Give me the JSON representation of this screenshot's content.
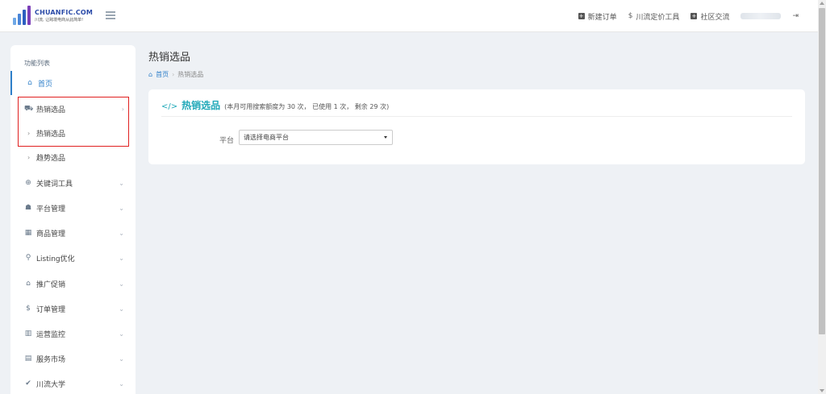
{
  "header": {
    "logo_title": "CHUANFIC.COM",
    "logo_subtitle": "川流, 让跨境电商从此简单!",
    "links": [
      {
        "label": "新建订单"
      },
      {
        "label": "川流定价工具"
      },
      {
        "label": "社区交流"
      }
    ]
  },
  "sidebar": {
    "title": "功能列表",
    "items": [
      {
        "label": "首页"
      },
      {
        "label": "热销选品"
      },
      {
        "label": "热销选品"
      },
      {
        "label": "趋势选品"
      },
      {
        "label": "关键词工具"
      },
      {
        "label": "平台管理"
      },
      {
        "label": "商品管理"
      },
      {
        "label": "Listing优化"
      },
      {
        "label": "推广促销"
      },
      {
        "label": "订单管理"
      },
      {
        "label": "运营监控"
      },
      {
        "label": "服务市场"
      },
      {
        "label": "川流大学"
      }
    ]
  },
  "main": {
    "page_title": "热销选品",
    "breadcrumb_home": "首页",
    "breadcrumb_current": "热销选品",
    "card_title": "热销选品",
    "card_subtitle": "(本月可用搜索额度为 30 次， 已使用 1 次， 剩余 29 次)",
    "platform_label": "平台",
    "platform_select_value": "请选择电商平台"
  },
  "colors": {
    "accent": "#2f7fc9",
    "card_title": "#1fa8b8",
    "highlight": "#e02020"
  }
}
